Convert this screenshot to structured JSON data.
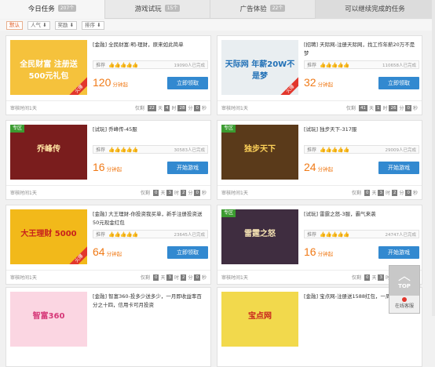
{
  "tabs": [
    {
      "label": "今日任务",
      "count": "207个",
      "active": true
    },
    {
      "label": "游戏试玩",
      "count": "15个"
    },
    {
      "label": "广告体验",
      "count": "22个"
    },
    {
      "label": "可以继续完成的任务"
    }
  ],
  "sorts": [
    {
      "label": "默认",
      "active": true
    },
    {
      "label": "人气 ⬇"
    },
    {
      "label": "奖励 ⬇"
    },
    {
      "label": "排序 ⬇"
    }
  ],
  "cards": [
    {
      "title": "[金融] 全民财富:明-理财，原来如此简单",
      "tag": "推荐",
      "stars": "👍👍👍👍👍",
      "done": "19090人已完成",
      "price": "120",
      "unit": "分钟起",
      "button": "立即领取",
      "audit": "审核时间1天",
      "cd_label": "仅剩",
      "d": "22",
      "h": "4",
      "m": "28",
      "s": "0",
      "units": [
        "天",
        "时",
        "分",
        "秒"
      ],
      "img_text": "全民财富 注册送500元礼包",
      "img_bg": "#f5c23c",
      "img_fg": "#fff",
      "zone": "",
      "corner": "火爆"
    },
    {
      "title": "[招聘] 天际网-注册天际网，找工作年薪20万不是梦",
      "tag": "推荐",
      "stars": "👍👍👍👍👍",
      "done": "110658人已完成",
      "price": "32",
      "unit": "分钟起",
      "button": "立即领取",
      "audit": "审核时间1天",
      "cd_label": "仅剩",
      "d": "41",
      "h": "1",
      "m": "26",
      "s": "0",
      "units": [
        "天",
        "时",
        "分",
        "秒"
      ],
      "img_text": "天际网 年薪20W不是梦",
      "img_bg": "#e9eef1",
      "img_fg": "#1f6fb6",
      "zone": "",
      "corner": "火爆"
    },
    {
      "title": "[试玩] 乔峰传-45服",
      "tag": "推荐",
      "stars": "👍👍👍👍👍",
      "done": "30583人已完成",
      "price": "16",
      "unit": "分钟起",
      "button": "开始游戏",
      "audit": "审核时间1天",
      "cd_label": "仅剩",
      "d": "0",
      "h": "3",
      "m": "2",
      "s": "0",
      "units": [
        "天",
        "时",
        "分",
        "秒"
      ],
      "img_text": "乔峰传",
      "img_bg": "#7a1d1d",
      "img_fg": "#ffe3a3",
      "zone": "专区",
      "corner": ""
    },
    {
      "title": "[试玩] 独步天下-317服",
      "tag": "推荐",
      "stars": "👍👍👍👍👍",
      "done": "29009人已完成",
      "price": "24",
      "unit": "分钟起",
      "button": "开始游戏",
      "audit": "审核时间1天",
      "cd_label": "仅剩",
      "d": "0",
      "h": "3",
      "m": "2",
      "s": "0",
      "units": [
        "天",
        "时",
        "分",
        "秒"
      ],
      "img_text": "独步天下",
      "img_bg": "#5a3a1a",
      "img_fg": "#ffd35a",
      "zone": "专区",
      "corner": ""
    },
    {
      "title": "[金融] 大王理财-你投资我买单，新手注册投资送50元现金红包",
      "tag": "推荐",
      "stars": "👍👍👍👍👍",
      "done": "23645人已完成",
      "price": "64",
      "unit": "分钟起",
      "button": "立即领取",
      "audit": "审核时间1天",
      "cd_label": "仅剩",
      "d": "0",
      "h": "3",
      "m": "2",
      "s": "0",
      "units": [
        "天",
        "时",
        "分",
        "秒"
      ],
      "img_text": "大王理财 5000",
      "img_bg": "#f2b91a",
      "img_fg": "#c8221c",
      "zone": "",
      "corner": "火爆"
    },
    {
      "title": "[试玩] 雷霆之怒-3服，霸气来袭",
      "tag": "推荐",
      "stars": "👍👍👍👍👍",
      "done": "24747人已完成",
      "price": "16",
      "unit": "分钟起",
      "button": "开始游戏",
      "audit": "审核时间1天",
      "cd_label": "仅剩",
      "d": "0",
      "h": "3",
      "m": "2",
      "s": "0",
      "units": [
        "天",
        "时",
        "分",
        "秒"
      ],
      "img_text": "雷霆之怒",
      "img_bg": "#3f2d40",
      "img_fg": "#f5e2b3",
      "zone": "专区",
      "corner": ""
    },
    {
      "title": "[金融] 智富360-投多少送多少，一月即收益率百分之十四，信用卡可月投资",
      "tag": "",
      "stars": "",
      "done": "",
      "price": "",
      "unit": "",
      "button": "",
      "audit": "",
      "cd_label": "",
      "d": "",
      "h": "",
      "m": "",
      "s": "",
      "units": [],
      "img_text": "智富360",
      "img_bg": "#fbd6e2",
      "img_fg": "#d63878",
      "zone": "",
      "corner": ""
    },
    {
      "title": "[金融] 宝点网-注册送1588红包，一周内理财",
      "tag": "",
      "stars": "",
      "done": "",
      "price": "",
      "unit": "",
      "button": "",
      "audit": "",
      "cd_label": "",
      "d": "",
      "h": "",
      "m": "",
      "s": "",
      "units": [],
      "img_text": "宝点网",
      "img_bg": "#f2d94c",
      "img_fg": "#c8221c",
      "zone": "",
      "corner": ""
    }
  ],
  "top_button": {
    "label": "TOP",
    "service": "在线客服"
  }
}
